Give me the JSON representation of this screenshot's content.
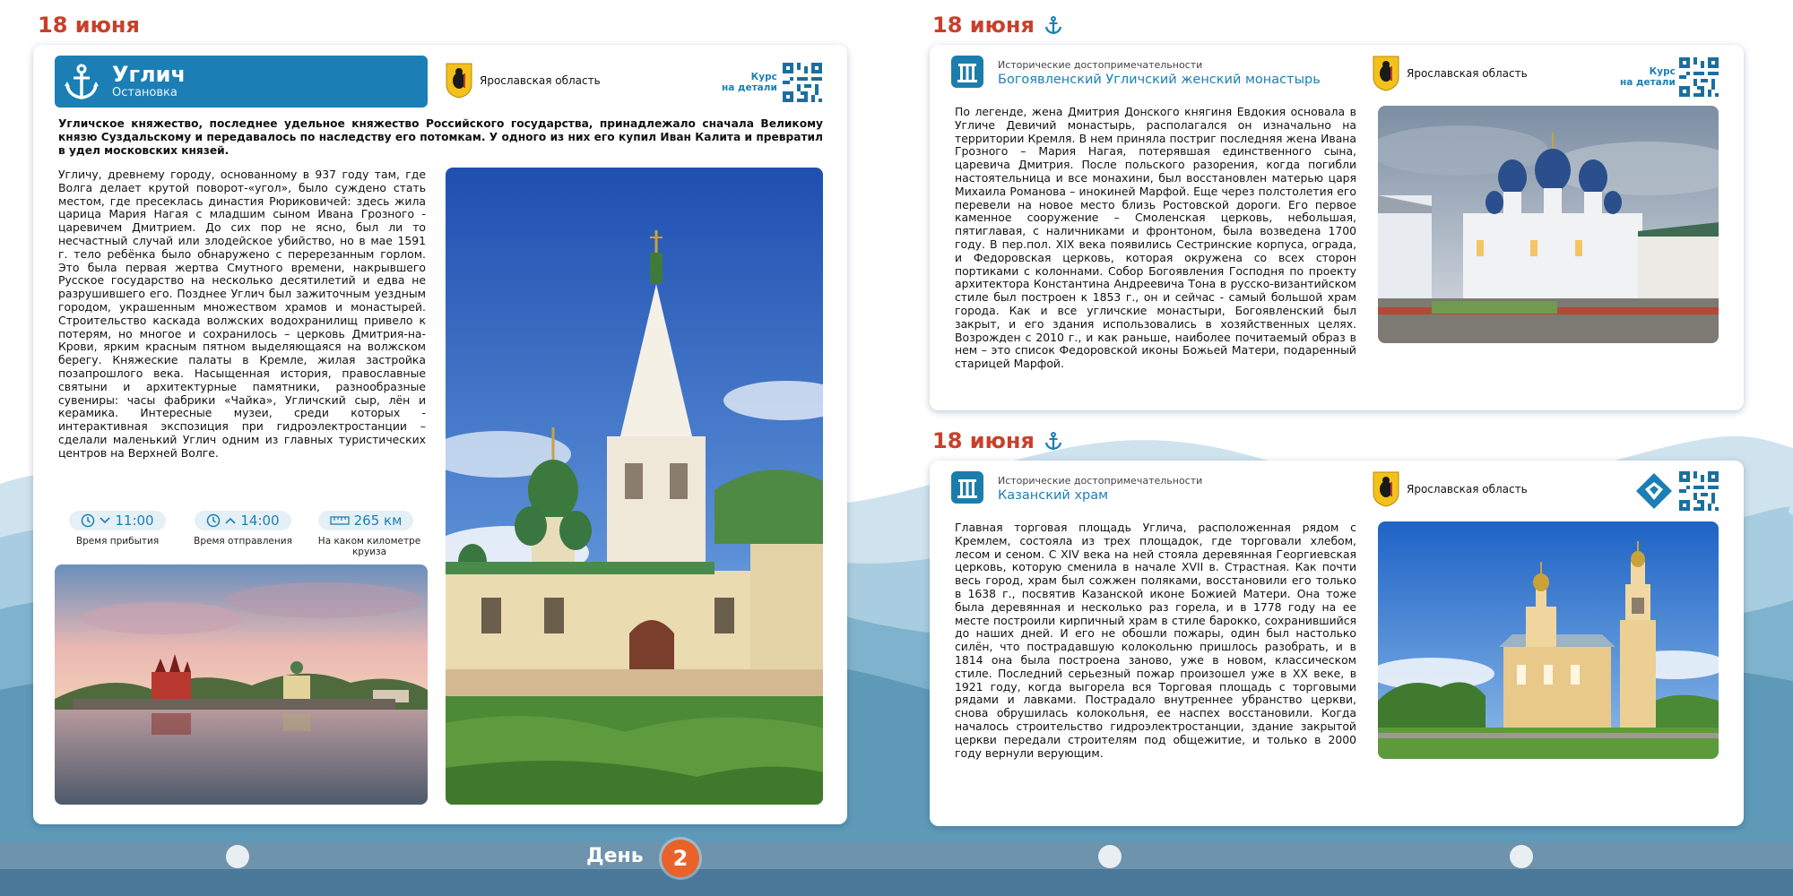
{
  "left_page": {
    "date": "18 июня",
    "stop": {
      "name": "Углич",
      "type": "Остановка",
      "region": "Ярославская область",
      "course_label_1": "Курс",
      "course_label_2": "на детали"
    },
    "lead": "Угличское княжество, последнее удельное княжество Российского государства, принадлежало сначала Великому князю Суздальскому и передавалось по наследству его потомкам. У одного из них его купил Иван Калита и превратил в удел московских князей.",
    "body": "Угличу, древнему городу, основанному в 937 году там, где Волга делает крутой поворот-«угол», было суждено стать местом, где пресеклась династия Рюриковичей: здесь жила царица Мария Нагая с младшим сыном Ивана Грозного - царевичем Дмитрием. До сих пор не ясно, был ли то несчастный случай или злодейское убийство, но в мае 1591 г. тело ребёнка было обнаружено с перерезанным горлом. Это была первая жертва Смутного времени, накрывшего Русское государство на несколько десятилетий и едва не разрушившего его. Позднее Углич был зажиточным уездным городом, украшенным множеством храмов и монастырей. Строительство каскада волжских водохранилищ привело к потерям, но многое и сохранилось – церковь Дмитрия-на-Крови, ярким красным пятном выделяющаяся на волжском берегу. Княжеские палаты в Кремле, жилая застройка позапрошлого века. Насыщенная история, православные святыни и архитектурные памятники, разнообразные сувениры: часы фабрики «Чайка», Угличский сыр, лён и керамика. Интересные музеи, среди которых - интерактивная экспозиция при гидроэлектростанции – сделали маленький Углич одним из главных туристических центров на Верхней Волге.",
    "arrival_time": "11:00",
    "arrival_label": "Время прибытия",
    "departure_time": "14:00",
    "departure_label": "Время отправления",
    "km": "265 км",
    "km_label": "На каком километре круиза"
  },
  "right_top": {
    "date": "18 июня",
    "kind": "Исторические достопримечательности",
    "name": "Богоявленский Угличский женский монастырь",
    "region": "Ярославская область",
    "course_label_1": "Курс",
    "course_label_2": "на детали",
    "body": "По легенде, жена Дмитрия Донского княгиня Евдокия основала в Угличе Девичий монастырь, располагался он изначально на территории Кремля. В нем приняла постриг последняя жена Ивана Грозного – Мария Нагая, потерявшая единственного сына, царевича Дмитрия. После польского разорения, когда погибли настоятельница и все монахини, был восстановлен матерью царя Михаила Романова – инокиней Марфой. Еще через полстолетия его перевели на новое место близь Ростовской дороги. Его первое каменное сооружение – Смоленская церковь, небольшая, пятиглавая, с наличниками и фронтоном, была возведена 1700 году. В пер.пол. XIX века появились Сестринские корпуса, ограда, и Федоровская церковь, которая окружена со всех сторон портиками с колоннами. Собор Богоявления Господня по проекту архитектора Константина Андреевича Тона в русско-византийском стиле был построен к 1853 г., он и сейчас - самый большой храм города. Как и все угличские монастыри, Богоявленский был закрыт, и его здания использовались в хозяйственных целях. Возрожден с 2010 г., и как раньше, наиболее почитаемый образ в нем – это список Федоровской иконы Божьей Матери, подаренный старицей Марфой."
  },
  "right_bottom": {
    "date": "18 июня",
    "kind": "Исторические достопримечательности",
    "name": "Казанский храм",
    "region": "Ярославская область",
    "body": "Главная торговая площадь Углича, расположенная рядом с Кремлем, состояла из трех площадок, где торговали хлебом, лесом и сеном. С XIV века на ней стояла деревянная Георгиевская церковь, которую сменила в начале XVII в. Страстная. Как почти весь город, храм был сожжен поляками, восстановили его только в 1638 г., посвятив Казанской иконе Божией Матери. Она тоже была деревянная и несколько раз горела, и в 1778 году на ее месте построили кирпичный храм в стиле барокко, сохранившийся до наших дней. И его не обошли пожары, один был настолько силён, что пострадавшую колокольню пришлось разобрать, и в 1814 она была построена заново, уже в новом, классическом стиле. Последний серьезный пожар произошел уже в XX веке, в 1921 году, когда выгорела вся Торговая площадь с торговыми рядами и лавками. Пострадало внутреннее убранство церкви, снова обрушилась колокольня, ее наспех восстановили. Когда началось строительство гидроэлектростанции, здание закрытой церкви передали строителям под общежитие, и только в 2000 году вернули верующим."
  },
  "footer": {
    "day_label": "День",
    "day_number": "2"
  },
  "colors": {
    "accent_red": "#c8402b",
    "brand_blue": "#1b7fb5",
    "day_orange": "#e8622a"
  }
}
